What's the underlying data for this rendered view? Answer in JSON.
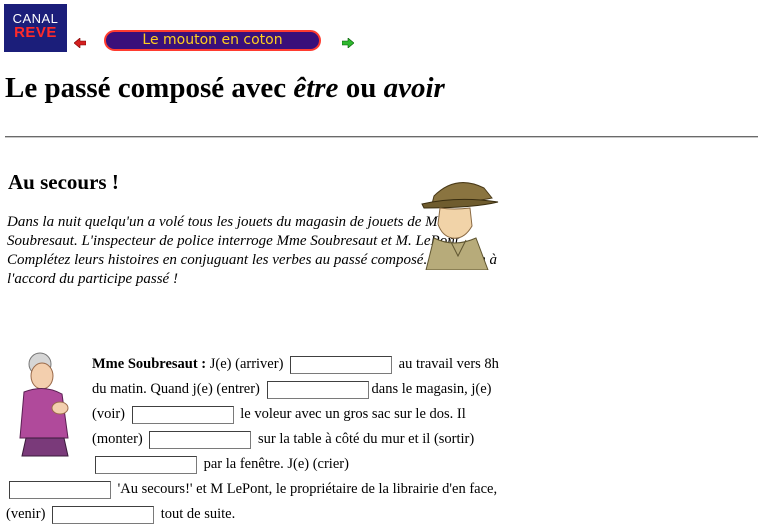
{
  "nav": {
    "logo_line1": "CANAL",
    "logo_line2": "REVE",
    "story_title": "Le mouton en coton"
  },
  "page": {
    "title_a": "Le passé composé avec ",
    "title_b": "être",
    "title_c": " ou ",
    "title_d": "avoir"
  },
  "section": {
    "title": "Au secours !",
    "intro": "Dans la nuit quelqu'un a volé tous les jouets du magasin de jouets de Mme Soubresaut. L'inspecteur de police interroge Mme Soubresaut et M. LePont. Complétez leurs histoires en conjuguant les verbes au passé composé. Attention à l'accord du participe passé !"
  },
  "exercise": {
    "speaker": "Mme Soubresaut :",
    "t1": " J(e) (arriver) ",
    "t2": " au travail vers 8h du matin. Quand j(e) (entrer) ",
    "t3": "dans le magasin, j(e) (voir) ",
    "t4": " le voleur avec un gros sac sur le dos. Il (monter) ",
    "t5": " sur la table à côté du mur et il (sortir) ",
    "t6": " par la fenêtre. J(e) (crier)",
    "t7": " 'Au secours!' et M LePont, le propriétaire de la librairie d'en face, (venir) ",
    "t8": " tout de suite.",
    "blanks": [
      "",
      "",
      "",
      "",
      "",
      "",
      "",
      ""
    ]
  }
}
